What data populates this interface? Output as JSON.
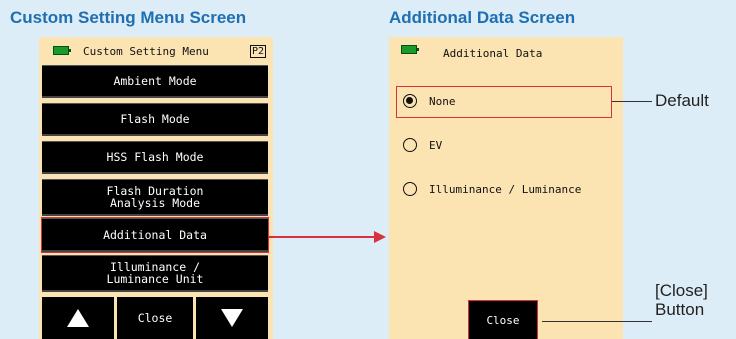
{
  "headings": {
    "left": "Custom Setting Menu Screen",
    "right": "Additional Data Screen"
  },
  "left_screen": {
    "title": "Custom Setting Menu",
    "page_badge": "P2",
    "items": [
      {
        "label": "Ambient Mode"
      },
      {
        "label": "Flash Mode"
      },
      {
        "label": "HSS Flash Mode"
      },
      {
        "label": "Flash Duration",
        "label2": "Analysis Mode"
      },
      {
        "label": "Additional Data",
        "selected": true
      },
      {
        "label": "Illuminance /",
        "label2": "Luminance Unit"
      }
    ],
    "bottom": {
      "up_icon": "triangle-up-icon",
      "close_label": "Close",
      "down_icon": "triangle-down-icon"
    }
  },
  "right_screen": {
    "title": "Additional Data",
    "options": [
      {
        "label": "None",
        "checked": true
      },
      {
        "label": "EV",
        "checked": false
      },
      {
        "label": "Illuminance / Luminance",
        "checked": false
      }
    ],
    "close_label": "Close"
  },
  "callouts": {
    "default_label": "Default",
    "close_label_line1": "[Close]",
    "close_label_line2": "Button"
  },
  "colors": {
    "heading": "#1f6fb2",
    "screen_bg": "#fce3b2",
    "highlight": "#d9303d",
    "battery": "#1a9a2a",
    "page_bg": "#dcedf8"
  }
}
